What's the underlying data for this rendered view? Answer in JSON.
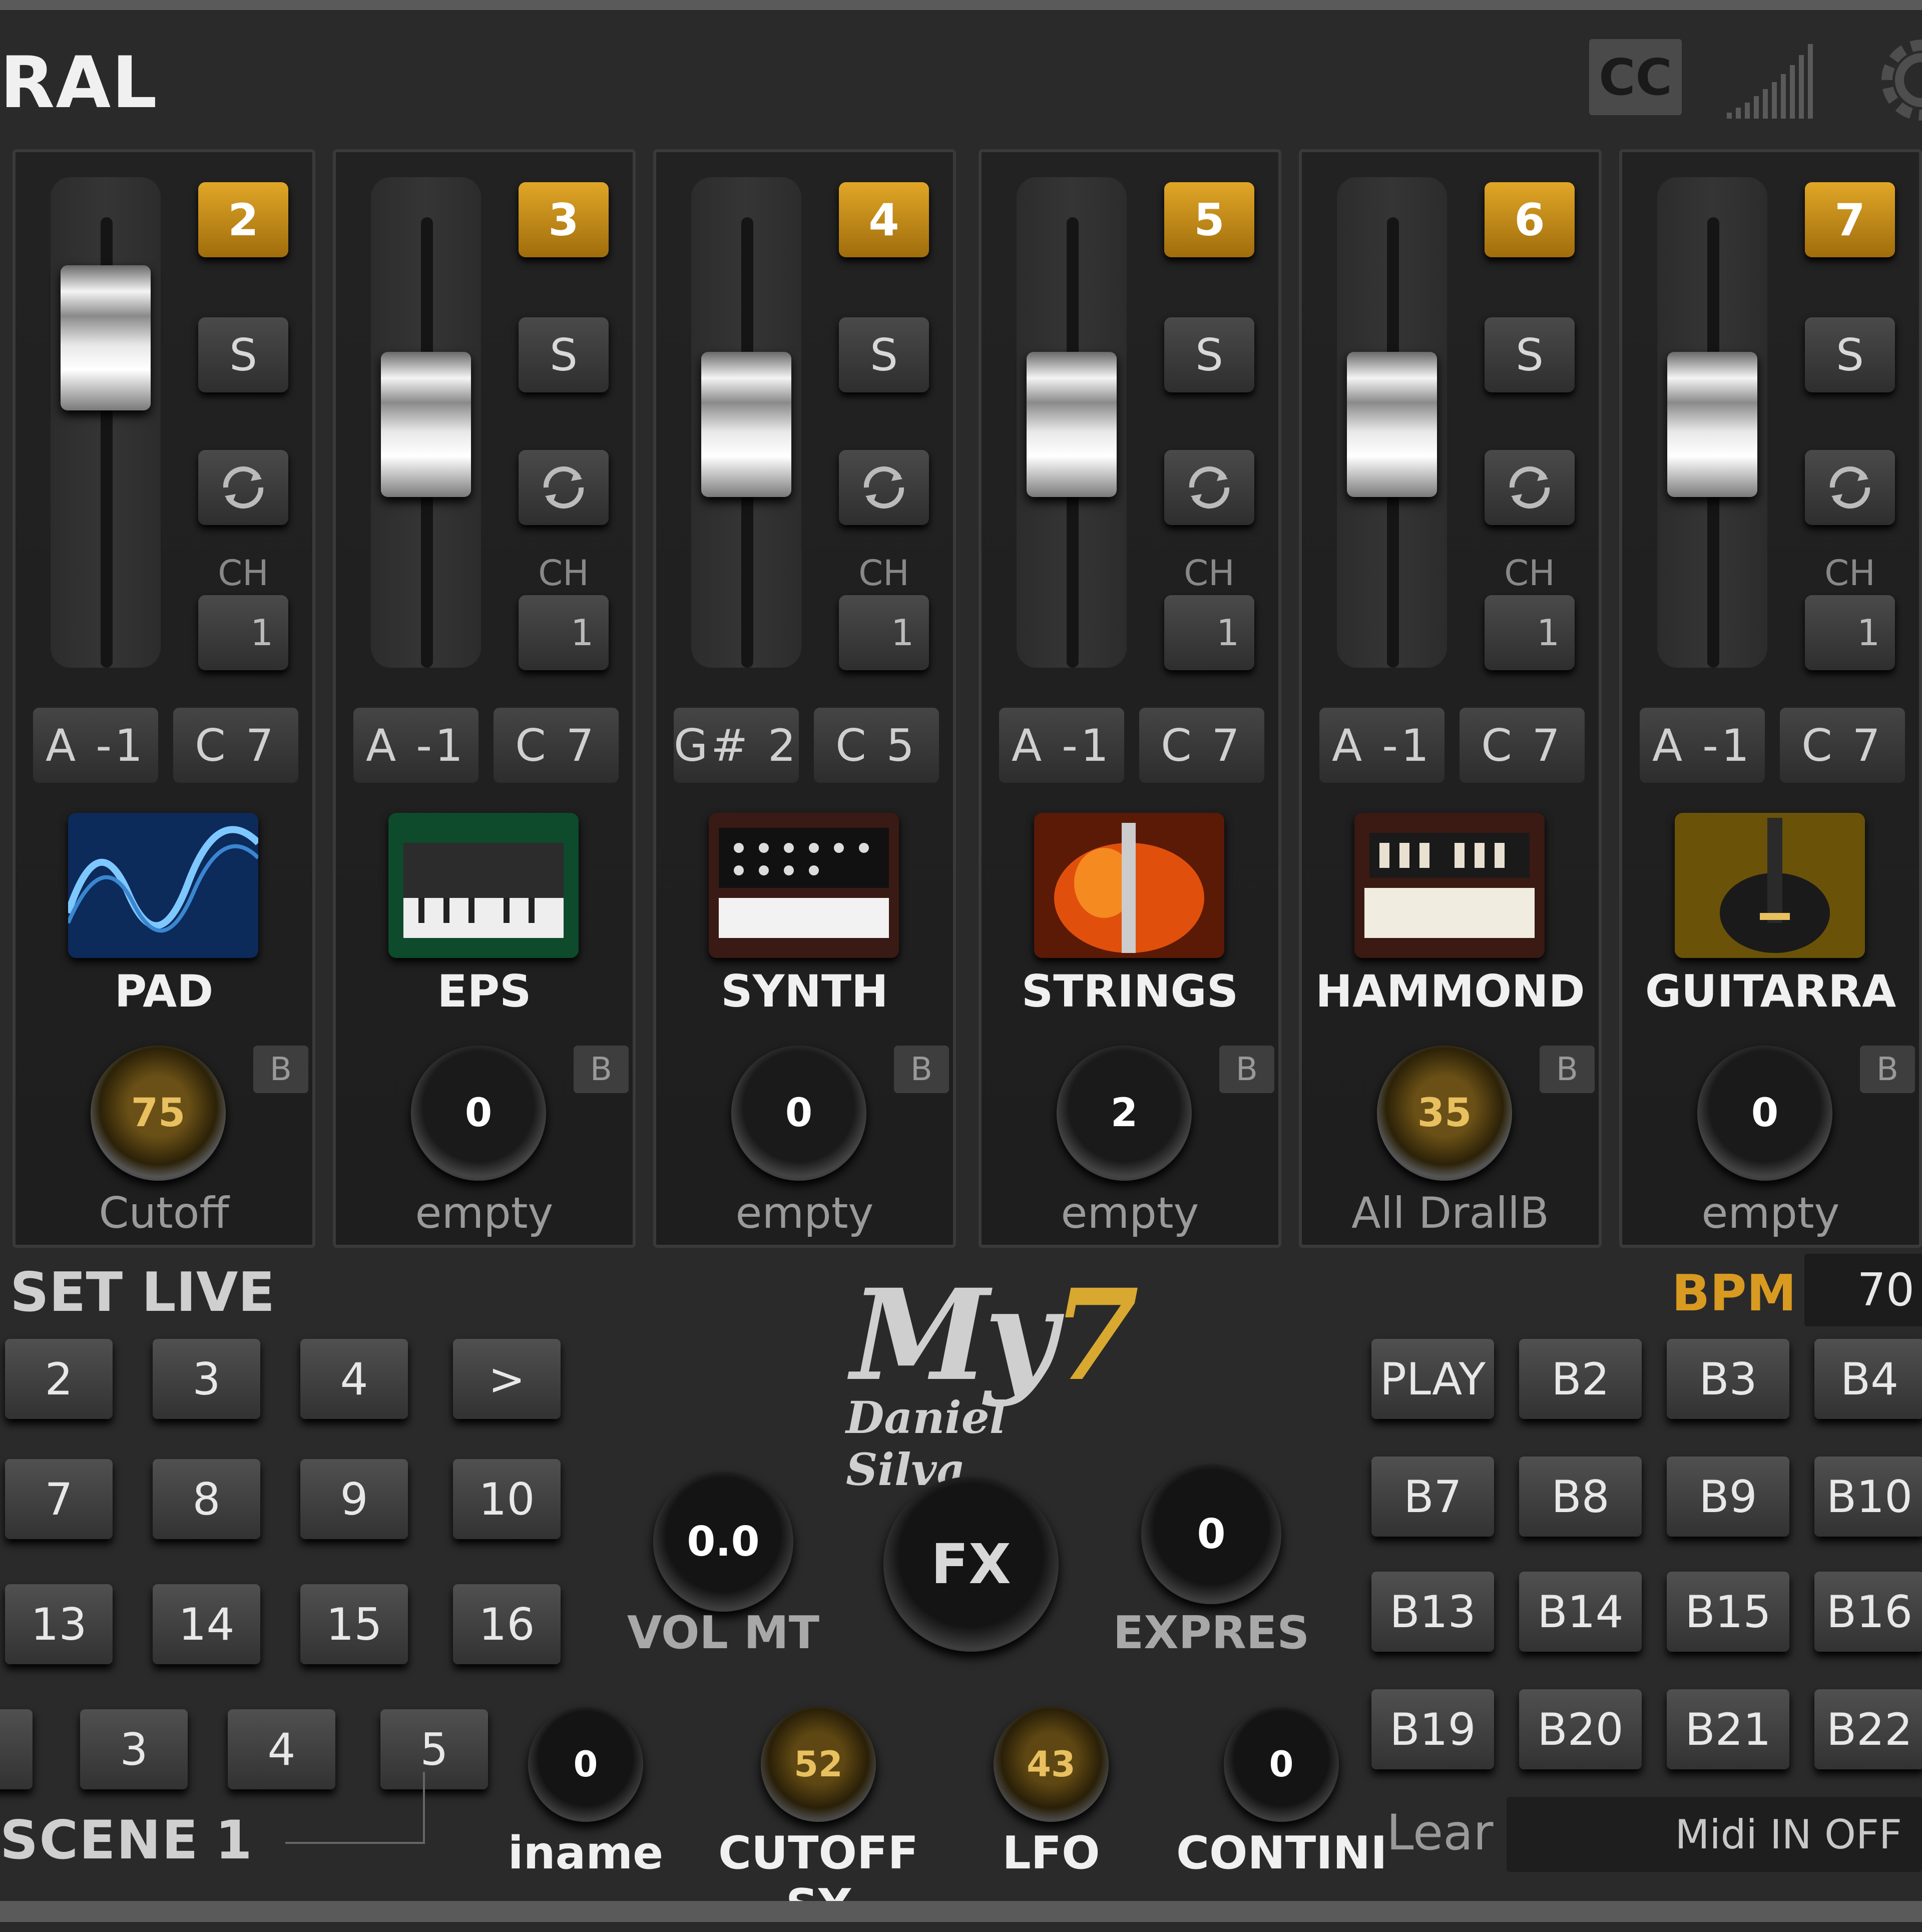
{
  "header": {
    "title": "RAL",
    "cc_label": "CC",
    "icons": [
      "signal-bars-icon",
      "gear-icon"
    ]
  },
  "channels": [
    {
      "number": "2",
      "solo": "S",
      "ch_label": "CH",
      "ch_value": "1",
      "low_note": "A -1",
      "high_note": "C 7",
      "instrument": "PAD",
      "knob_value": "75",
      "param": "Cutoff",
      "b_label": "B",
      "fader_level": 0.74
    },
    {
      "number": "3",
      "solo": "S",
      "ch_label": "CH",
      "ch_value": "1",
      "low_note": "A -1",
      "high_note": "C 7",
      "instrument": "EPS",
      "knob_value": "0",
      "param": "empty",
      "b_label": "B",
      "fader_level": 0.43
    },
    {
      "number": "4",
      "solo": "S",
      "ch_label": "CH",
      "ch_value": "1",
      "low_note": "G# 2",
      "high_note": "C 5",
      "instrument": "SYNTH",
      "knob_value": "0",
      "param": "empty",
      "b_label": "B",
      "fader_level": 0.43
    },
    {
      "number": "5",
      "solo": "S",
      "ch_label": "CH",
      "ch_value": "1",
      "low_note": "A -1",
      "high_note": "C 7",
      "instrument": "STRINGS",
      "knob_value": "2",
      "param": "empty",
      "b_label": "B",
      "fader_level": 0.43
    },
    {
      "number": "6",
      "solo": "S",
      "ch_label": "CH",
      "ch_value": "1",
      "low_note": "A -1",
      "high_note": "C 7",
      "instrument": "HAMMOND",
      "knob_value": "35",
      "param": "All DrallB",
      "b_label": "B",
      "fader_level": 0.43
    },
    {
      "number": "7",
      "solo": "S",
      "ch_label": "CH",
      "ch_value": "1",
      "low_note": "A -1",
      "high_note": "C 7",
      "instrument": "GUITARRA",
      "knob_value": "0",
      "param": "empty",
      "b_label": "B",
      "fader_level": 0.43
    }
  ],
  "setlive": {
    "title": "SET LIVE",
    "grid": [
      [
        "2",
        "3",
        "4",
        ">"
      ],
      [
        "7",
        "8",
        "9",
        "10"
      ],
      [
        "13",
        "14",
        "15",
        "16"
      ]
    ],
    "scene_row": [
      "3",
      "4",
      "5"
    ],
    "scene_label": "SCENE",
    "scene_number": "1"
  },
  "logo": {
    "main": "My",
    "accent": "7",
    "sub": "Daniel Silva"
  },
  "center": {
    "vol_mt_value": "0.0",
    "vol_mt_label": "VOL MT",
    "fx_label": "FX",
    "expres_value": "0",
    "expres_label": "EXPRES"
  },
  "bottom_knobs": [
    {
      "value": "0",
      "label": "iname"
    },
    {
      "value": "52",
      "label": "CUTOFF SY"
    },
    {
      "value": "43",
      "label": "LFO"
    },
    {
      "value": "0",
      "label": "CONTINI"
    }
  ],
  "bpm": {
    "label": "BPM",
    "value": "70"
  },
  "buttons_grid": [
    [
      "PLAY",
      "B2",
      "B3",
      "B4"
    ],
    [
      "B7",
      "B8",
      "B9",
      "B10"
    ],
    [
      "B13",
      "B14",
      "B15",
      "B16"
    ],
    [
      "B19",
      "B20",
      "B21",
      "B22"
    ]
  ],
  "learn_label": "Lear",
  "midi_status": "Midi IN OFF",
  "colors": {
    "accent_gold": "#d89a20",
    "panel": "#222222",
    "background": "#2a2a2a"
  }
}
